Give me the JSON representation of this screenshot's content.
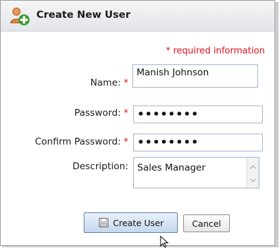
{
  "dialog": {
    "title": "Create New User",
    "title_icon": "add-user-icon"
  },
  "form": {
    "required_note": "* required information",
    "name_label": "Name:",
    "name_value": "Manish Johnson",
    "password_label": "Password:",
    "password_value": "••••••••",
    "confirm_label": "Confirm Password:",
    "confirm_value": "••••••••",
    "required_star": "*",
    "description_label": "Description:",
    "description_value": "Sales Manager"
  },
  "buttons": {
    "create_label": "Create User",
    "create_icon": "save-disk-icon",
    "cancel_label": "Cancel"
  },
  "colors": {
    "required_red": "#e0101a",
    "field_border": "#9fb3cf",
    "primary_button": "#c6d8ee"
  }
}
